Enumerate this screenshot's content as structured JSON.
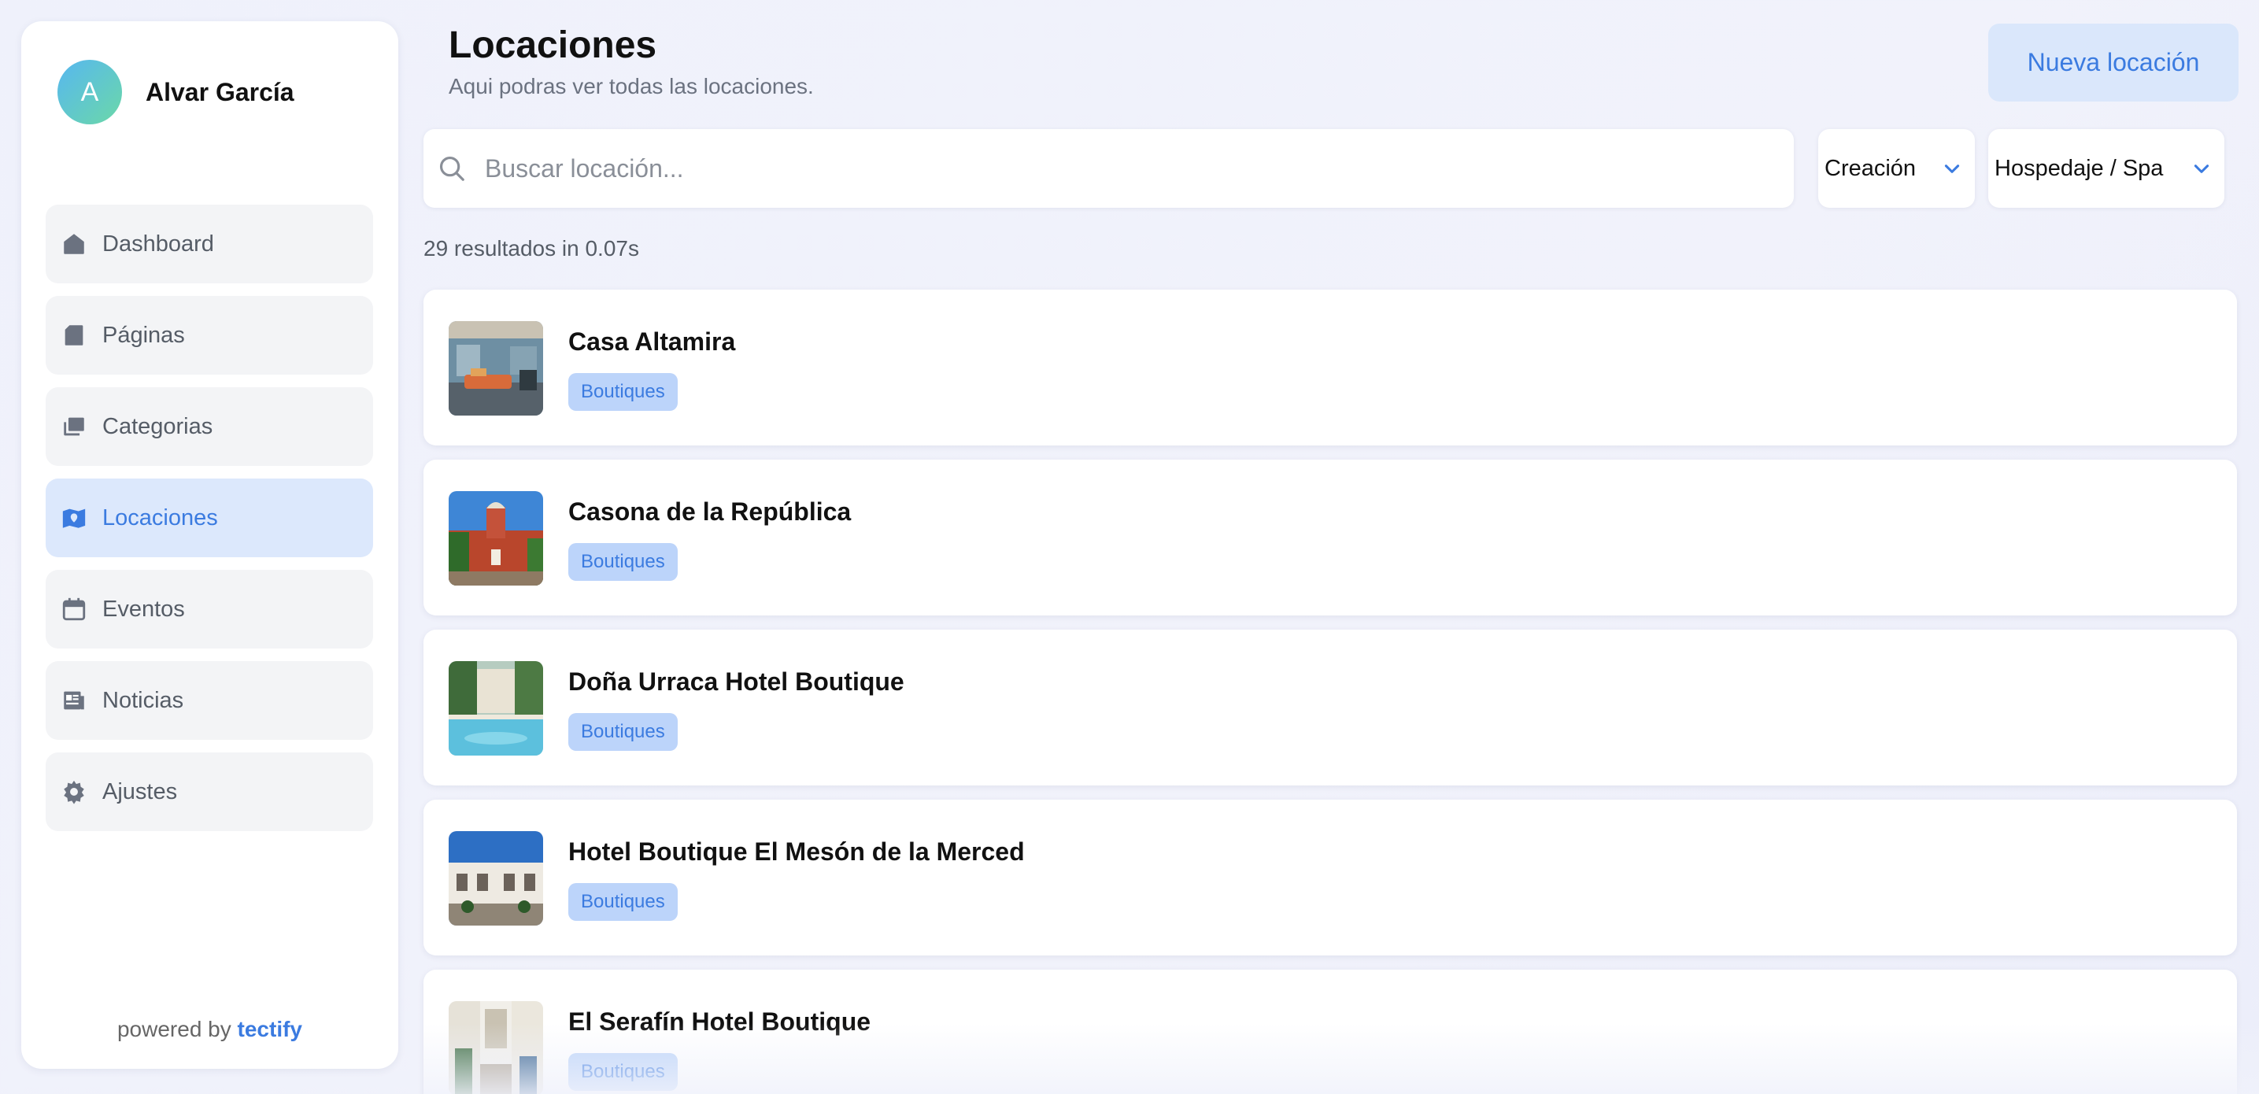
{
  "sidebar": {
    "user": {
      "initial": "A",
      "name": "Alvar García"
    },
    "items": [
      {
        "label": "Dashboard",
        "icon": "home-icon"
      },
      {
        "label": "Páginas",
        "icon": "page-icon"
      },
      {
        "label": "Categorias",
        "icon": "folders-icon"
      },
      {
        "label": "Locaciones",
        "icon": "map-pin-icon",
        "active": true
      },
      {
        "label": "Eventos",
        "icon": "calendar-icon"
      },
      {
        "label": "Noticias",
        "icon": "newspaper-icon"
      },
      {
        "label": "Ajustes",
        "icon": "gear-icon"
      }
    ],
    "powered_prefix": "powered by",
    "powered_brand": "tectify"
  },
  "header": {
    "title": "Locaciones",
    "subtitle": "Aqui podras ver todas las locaciones.",
    "new_button": "Nueva locación"
  },
  "search": {
    "placeholder": "Buscar locación..."
  },
  "filters": {
    "sort": {
      "selected": "Creación"
    },
    "category": {
      "selected": "Hospedaje / Spa"
    }
  },
  "results_text": "29 resultados in 0.07s",
  "locations": [
    {
      "name": "Casa Altamira",
      "tag": "Boutiques"
    },
    {
      "name": "Casona de la República",
      "tag": "Boutiques"
    },
    {
      "name": "Doña Urraca Hotel Boutique",
      "tag": "Boutiques"
    },
    {
      "name": "Hotel Boutique El Mesón de la Merced",
      "tag": "Boutiques"
    },
    {
      "name": "El Serafín Hotel Boutique",
      "tag": "Boutiques"
    }
  ],
  "colors": {
    "accent": "#3b7be0",
    "active_bg": "#dce8fc",
    "badge_bg": "#bcd4fa"
  }
}
